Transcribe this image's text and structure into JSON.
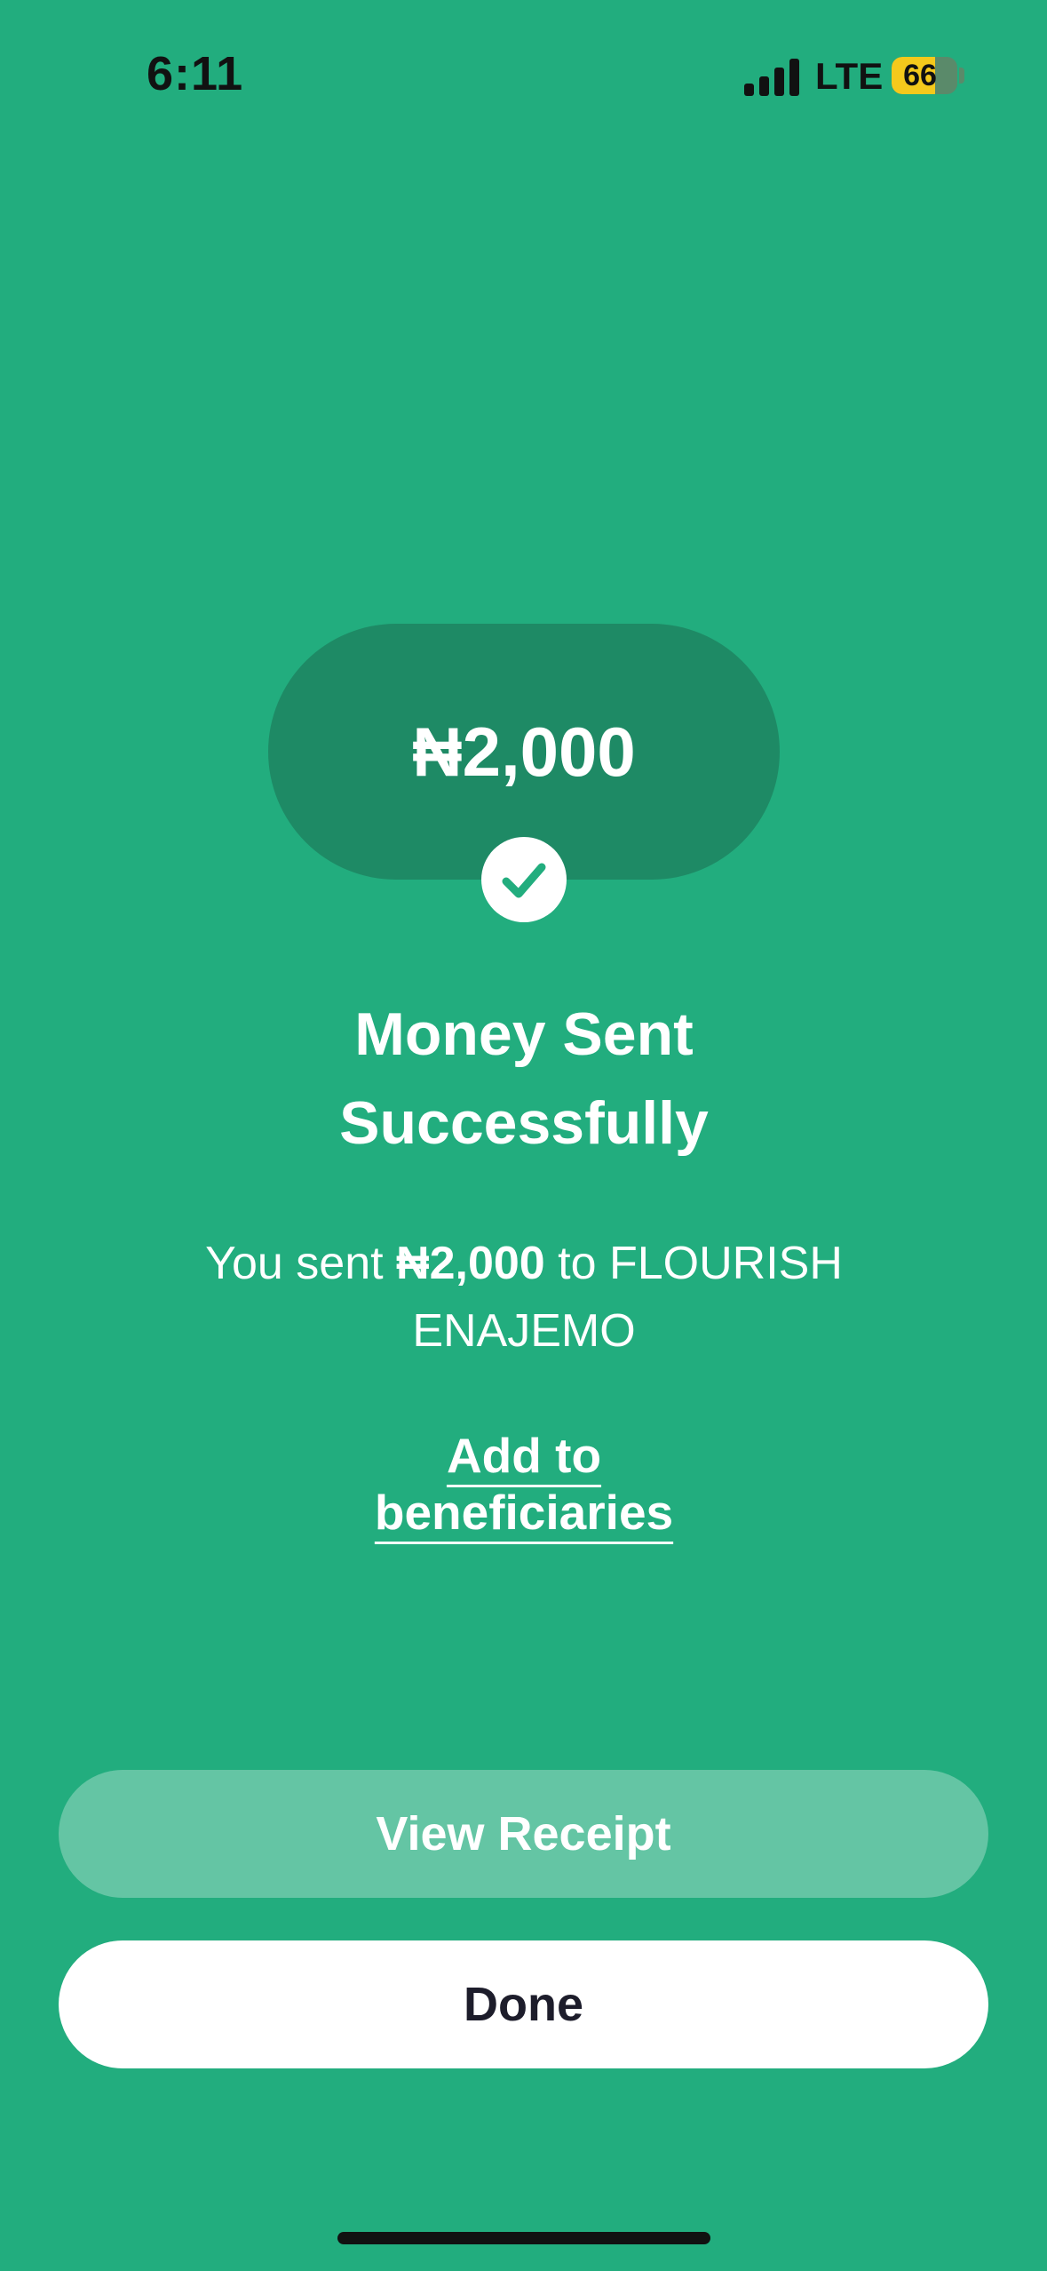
{
  "status_bar": {
    "time": "6:11",
    "network": "LTE",
    "battery_level": "66",
    "battery_fraction": 0.66,
    "signal_bars": 4
  },
  "amount_card": {
    "amount": "₦2,000"
  },
  "success": {
    "title_line1": "Money Sent",
    "title_line2": "Successfully",
    "message_prefix": "You sent ",
    "message_amount": "₦2,000",
    "message_suffix": " to FLOURISH ENAJEMO"
  },
  "links": {
    "add_beneficiary": "Add to beneficiaries"
  },
  "buttons": {
    "view_receipt": "View Receipt",
    "done": "Done"
  },
  "colors": {
    "background": "#22ad7e",
    "card": "#1e8a65",
    "receipt_button": "#64c5a4",
    "check": "#22ad7e"
  },
  "icons": {
    "check": "check-icon",
    "signal": "signal-icon",
    "battery": "battery-icon"
  }
}
